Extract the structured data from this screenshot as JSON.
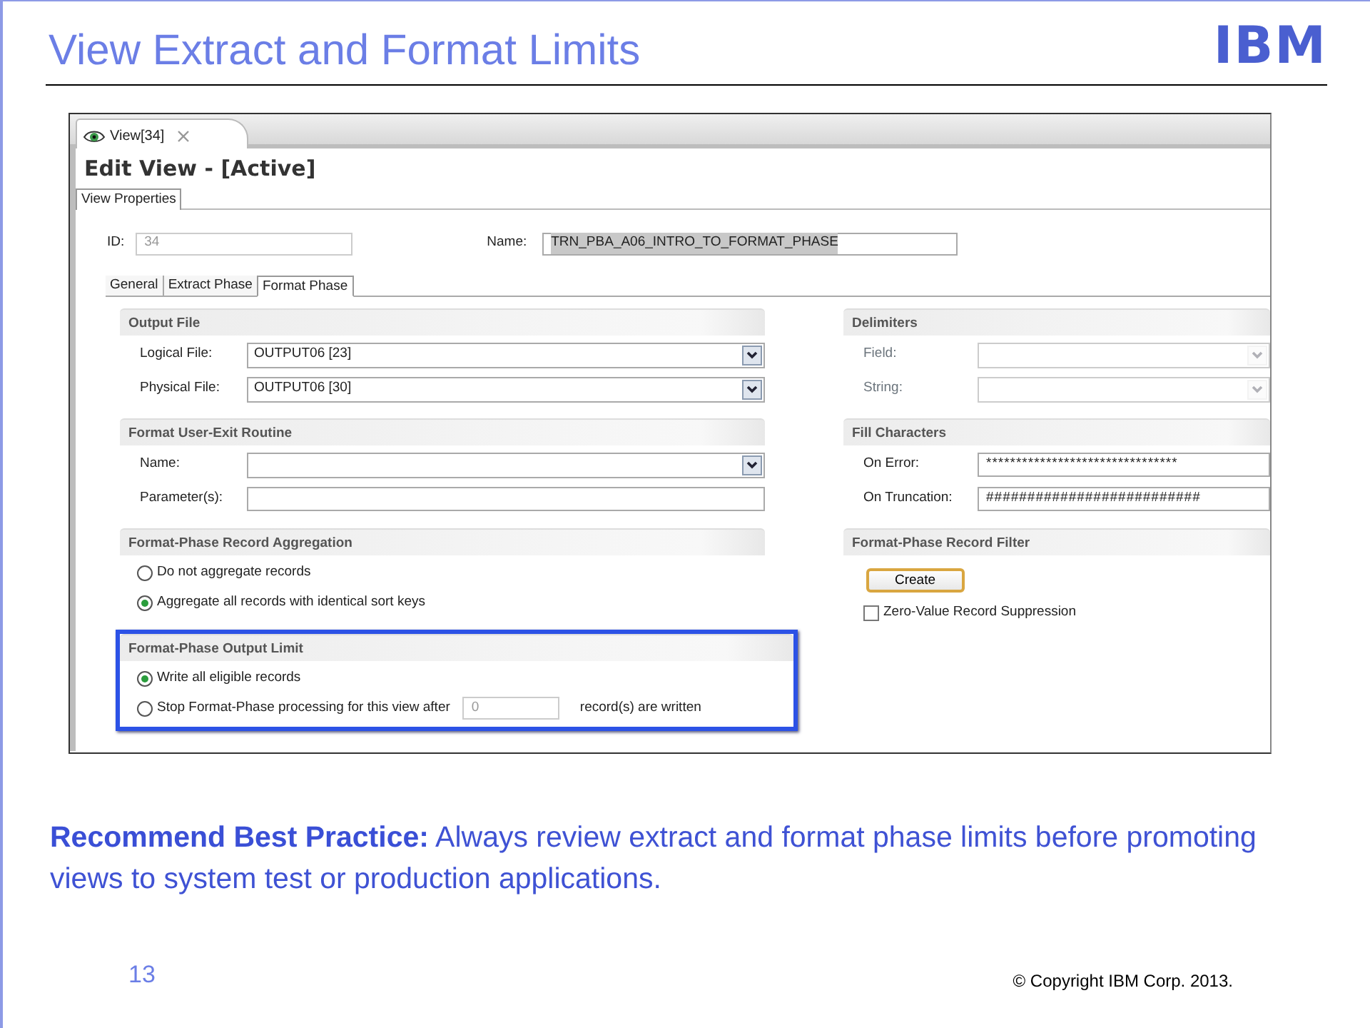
{
  "slide": {
    "title": "View Extract and Format Limits",
    "logo": "IBM"
  },
  "screenshot": {
    "editor_tabs": [
      {
        "label": "View[34]",
        "selected": true
      }
    ],
    "heading": "Edit View - [Active]",
    "page_tabs": [
      {
        "label": "View Properties",
        "selected": true
      }
    ],
    "id_field": {
      "label": "ID:",
      "value": "34",
      "disabled": true
    },
    "name_field": {
      "label": "Name:",
      "value": "TRN_PBA_A06_INTRO_TO_FORMAT_PHASE",
      "text_selected": true
    },
    "phase_tabs": [
      {
        "label": "General",
        "selected": false
      },
      {
        "label": "Extract Phase",
        "selected": false
      },
      {
        "label": "Format Phase",
        "selected": true
      }
    ],
    "left_sections": [
      {
        "title": "Output File",
        "kind": "fields",
        "fields": [
          {
            "label": "Logical File:",
            "value": "OUTPUT06 [23]",
            "kind": "dropdown",
            "disabled": false
          },
          {
            "label": "Physical File:",
            "value": "OUTPUT06 [30]",
            "kind": "dropdown",
            "disabled": false
          }
        ]
      },
      {
        "title": "Format User-Exit Routine",
        "kind": "fields",
        "fields": [
          {
            "label": "Name:",
            "kind": "dropdown",
            "disabled": false
          },
          {
            "label": "Parameter(s):",
            "kind": "text",
            "disabled": false
          }
        ]
      },
      {
        "title": "Format-Phase Record Aggregation",
        "kind": "radios",
        "highlighted": false,
        "options": [
          {
            "label": "Do not aggregate records",
            "selected": false
          },
          {
            "label": "Aggregate all records with identical sort keys",
            "selected": true
          }
        ]
      },
      {
        "title": "Format-Phase Output Limit",
        "kind": "radios",
        "highlighted": true,
        "options": [
          {
            "label": "Write all eligible records",
            "selected": true
          },
          {
            "label": "Stop Format-Phase processing for this view after",
            "selected": false,
            "value": "0",
            "suffix": "record(s) are written"
          }
        ]
      }
    ],
    "right_sections": [
      {
        "title": "Delimiters",
        "kind": "fields",
        "fields": [
          {
            "label": "Field:",
            "kind": "dropdown",
            "disabled": true
          },
          {
            "label": "String:",
            "kind": "dropdown",
            "disabled": true
          }
        ]
      },
      {
        "title": "Fill Characters",
        "kind": "fields",
        "fields": [
          {
            "label": "On Error:",
            "value": "********************************",
            "kind": "text",
            "disabled": false
          },
          {
            "label": "On Truncation:",
            "value": "##########################",
            "kind": "text",
            "disabled": false
          }
        ]
      },
      {
        "title": "Format-Phase Record Filter",
        "kind": "filter",
        "button": "Create",
        "checkbox": {
          "label": "Zero-Value Record Suppression",
          "checked": false
        }
      }
    ]
  },
  "note": "**Recommend Best Practice:** Always review extract and format phase limits before promoting views to system test or production applications.",
  "footer": {
    "page_number": "13",
    "copyright": "© Copyright  IBM Corp. 2013."
  }
}
